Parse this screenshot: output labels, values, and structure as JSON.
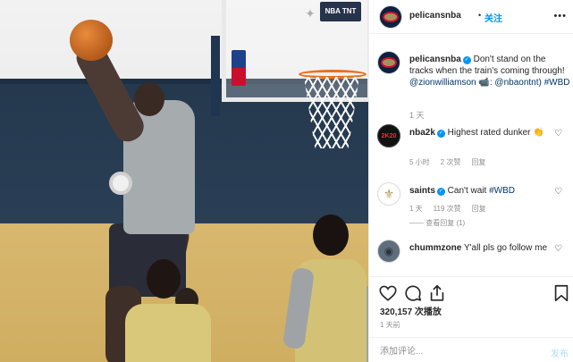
{
  "media": {
    "scoreboard_text": "NBA TNT"
  },
  "header": {
    "username": "pelicansnba",
    "dot": "•",
    "follow_label": "关注",
    "more_label": "•••"
  },
  "caption": {
    "username": "pelicansnba",
    "text_1": " Don't stand on the tracks when the train's coming through! ",
    "mention_1": "@zionwilliamson",
    "text_2": " 📹: ",
    "mention_2": "@nbaontnt)",
    "hashtag": " #WBD",
    "time": "1 天"
  },
  "comments": [
    {
      "username": "nba2k",
      "avatar_text": "2K20",
      "verified": true,
      "text": " Highest rated dunker 👏",
      "time": "5 小时",
      "likes": "2 次赞",
      "reply": "回复"
    },
    {
      "username": "saints",
      "avatar_text": "⚜",
      "verified": true,
      "text": " Can't wait ",
      "hashtag": "#WBD",
      "time": "1 天",
      "likes": "119 次赞",
      "reply": "回复",
      "view_replies": "—— 查看回复 (1)"
    },
    {
      "username": "chummzone",
      "avatar_text": "◉",
      "verified": false,
      "text": " Y'all pls go follow me"
    }
  ],
  "actions": {
    "likes_count": "320,157 次播放",
    "post_time": "1 天前"
  },
  "add_comment": {
    "placeholder": "添加评论...",
    "post_label": "发布"
  },
  "colors": {
    "accent": "#0095f6",
    "mention": "#00376b",
    "muted": "#8e8e8e"
  },
  "icons": [
    "heart-icon",
    "comment-icon",
    "share-icon",
    "bookmark-icon",
    "verified-icon",
    "more-icon"
  ]
}
